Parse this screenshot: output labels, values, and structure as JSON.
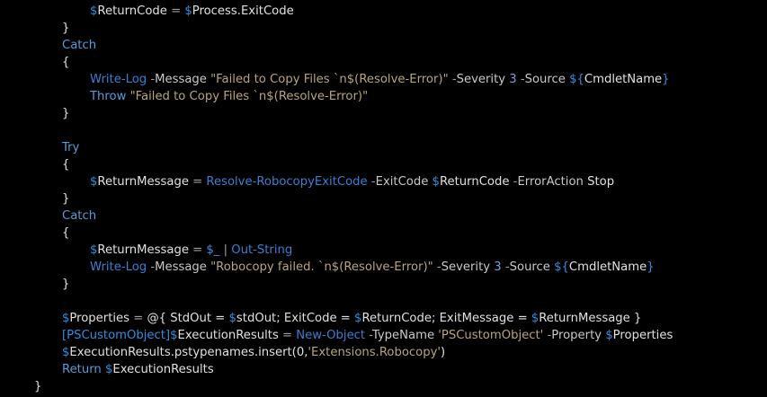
{
  "editor": {
    "background": "#000000",
    "colors": {
      "plain": "#e0e0e0",
      "variable": "#2f8fdf",
      "keyword": "#569cd6",
      "command": "#3a7fd0",
      "parameter": "#c8c8c8",
      "string": "#b8a47a",
      "number": "#7f9fd0"
    },
    "lines": [
      {
        "indent": 100,
        "tokens": [
          {
            "t": "$",
            "c": "var"
          },
          {
            "t": "ReturnCode",
            "c": "plain"
          },
          {
            "t": " = ",
            "c": "op"
          },
          {
            "t": "$",
            "c": "var"
          },
          {
            "t": "Process.ExitCode",
            "c": "plain"
          }
        ]
      },
      {
        "indent": 69,
        "tokens": [
          {
            "t": "}",
            "c": "plain"
          }
        ]
      },
      {
        "indent": 69,
        "tokens": [
          {
            "t": "Catch",
            "c": "kw"
          }
        ]
      },
      {
        "indent": 69,
        "tokens": [
          {
            "t": "{",
            "c": "plain"
          }
        ]
      },
      {
        "indent": 100,
        "tokens": [
          {
            "t": "Write-Log",
            "c": "cmd"
          },
          {
            "t": " -",
            "c": "op"
          },
          {
            "t": "Message",
            "c": "param"
          },
          {
            "t": " \"Failed to Copy Files `n$(Resolve-Error)\"",
            "c": "str"
          },
          {
            "t": " -",
            "c": "op"
          },
          {
            "t": "Severity",
            "c": "param"
          },
          {
            "t": " 3",
            "c": "num"
          },
          {
            "t": " -",
            "c": "op"
          },
          {
            "t": "Source",
            "c": "param"
          },
          {
            "t": " ${",
            "c": "var"
          },
          {
            "t": "CmdletName",
            "c": "plain"
          },
          {
            "t": "}",
            "c": "var"
          }
        ]
      },
      {
        "indent": 100,
        "tokens": [
          {
            "t": "Throw",
            "c": "kw"
          },
          {
            "t": " \"Failed to Copy Files `n$(Resolve-Error)\"",
            "c": "str"
          }
        ]
      },
      {
        "indent": 69,
        "tokens": [
          {
            "t": "}",
            "c": "plain"
          }
        ]
      },
      {
        "indent": 69,
        "tokens": []
      },
      {
        "indent": 69,
        "tokens": [
          {
            "t": "Try",
            "c": "kw"
          }
        ]
      },
      {
        "indent": 69,
        "tokens": [
          {
            "t": "{",
            "c": "plain"
          }
        ]
      },
      {
        "indent": 100,
        "tokens": [
          {
            "t": "$",
            "c": "var"
          },
          {
            "t": "ReturnMessage",
            "c": "plain"
          },
          {
            "t": " = ",
            "c": "op"
          },
          {
            "t": "Resolve-RobocopyExitCode",
            "c": "cmd"
          },
          {
            "t": " -",
            "c": "op"
          },
          {
            "t": "ExitCode",
            "c": "param"
          },
          {
            "t": " $",
            "c": "var"
          },
          {
            "t": "ReturnCode",
            "c": "plain"
          },
          {
            "t": " -",
            "c": "op"
          },
          {
            "t": "ErrorAction",
            "c": "param"
          },
          {
            "t": " Stop",
            "c": "plain"
          }
        ]
      },
      {
        "indent": 69,
        "tokens": [
          {
            "t": "}",
            "c": "plain"
          }
        ]
      },
      {
        "indent": 69,
        "tokens": [
          {
            "t": "Catch",
            "c": "kw"
          }
        ]
      },
      {
        "indent": 69,
        "tokens": [
          {
            "t": "{",
            "c": "plain"
          }
        ]
      },
      {
        "indent": 100,
        "tokens": [
          {
            "t": "$",
            "c": "var"
          },
          {
            "t": "ReturnMessage",
            "c": "plain"
          },
          {
            "t": " = ",
            "c": "op"
          },
          {
            "t": "$_",
            "c": "var"
          },
          {
            "t": " | ",
            "c": "op"
          },
          {
            "t": "Out-String",
            "c": "cmd"
          }
        ]
      },
      {
        "indent": 100,
        "tokens": [
          {
            "t": "Write-Log",
            "c": "cmd"
          },
          {
            "t": " -",
            "c": "op"
          },
          {
            "t": "Message",
            "c": "param"
          },
          {
            "t": " \"Robocopy failed. `n$(Resolve-Error)\"",
            "c": "str"
          },
          {
            "t": " -",
            "c": "op"
          },
          {
            "t": "Severity",
            "c": "param"
          },
          {
            "t": " 3",
            "c": "num"
          },
          {
            "t": " -",
            "c": "op"
          },
          {
            "t": "Source",
            "c": "param"
          },
          {
            "t": " ${",
            "c": "var"
          },
          {
            "t": "CmdletName",
            "c": "plain"
          },
          {
            "t": "}",
            "c": "var"
          }
        ]
      },
      {
        "indent": 69,
        "tokens": [
          {
            "t": "}",
            "c": "plain"
          }
        ]
      },
      {
        "indent": 69,
        "tokens": []
      },
      {
        "indent": 69,
        "tokens": [
          {
            "t": "$",
            "c": "var"
          },
          {
            "t": "Properties",
            "c": "plain"
          },
          {
            "t": " = ",
            "c": "op"
          },
          {
            "t": "@{ StdOut = ",
            "c": "plain"
          },
          {
            "t": "$",
            "c": "var"
          },
          {
            "t": "stdOut",
            "c": "plain"
          },
          {
            "t": "; ExitCode = ",
            "c": "plain"
          },
          {
            "t": "$",
            "c": "var"
          },
          {
            "t": "ReturnCode",
            "c": "plain"
          },
          {
            "t": "; ExitMessage = ",
            "c": "plain"
          },
          {
            "t": "$",
            "c": "var"
          },
          {
            "t": "ReturnMessage",
            "c": "plain"
          },
          {
            "t": " }",
            "c": "plain"
          }
        ]
      },
      {
        "indent": 69,
        "tokens": [
          {
            "t": "[PSCustomObject]",
            "c": "type"
          },
          {
            "t": "$",
            "c": "var"
          },
          {
            "t": "ExecutionResults",
            "c": "plain"
          },
          {
            "t": " = ",
            "c": "op"
          },
          {
            "t": "New-Object",
            "c": "cmd"
          },
          {
            "t": " -",
            "c": "op"
          },
          {
            "t": "TypeName",
            "c": "param"
          },
          {
            "t": " 'PSCustomObject'",
            "c": "str"
          },
          {
            "t": " -",
            "c": "op"
          },
          {
            "t": "Property",
            "c": "param"
          },
          {
            "t": " $",
            "c": "var"
          },
          {
            "t": "Properties",
            "c": "plain"
          }
        ]
      },
      {
        "indent": 69,
        "tokens": [
          {
            "t": "$",
            "c": "var"
          },
          {
            "t": "ExecutionResults.pstypenames.insert(0,",
            "c": "plain"
          },
          {
            "t": "'Extensions.Robocopy'",
            "c": "str"
          },
          {
            "t": ")",
            "c": "plain"
          }
        ]
      },
      {
        "indent": 69,
        "tokens": [
          {
            "t": "Return",
            "c": "kw"
          },
          {
            "t": " $",
            "c": "var"
          },
          {
            "t": "ExecutionResults",
            "c": "plain"
          }
        ]
      },
      {
        "indent": 38,
        "tokens": [
          {
            "t": "}",
            "c": "plain"
          }
        ]
      }
    ]
  }
}
